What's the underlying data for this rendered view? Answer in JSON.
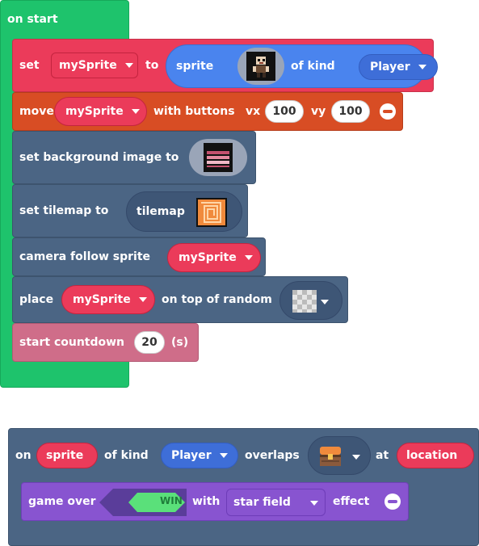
{
  "on_start": {
    "header": "on start",
    "set_sprite": {
      "set": "set",
      "variable": "mySprite",
      "to": "to",
      "sprite": "sprite",
      "of_kind": "of kind",
      "kind": "Player"
    },
    "move": {
      "label": "move",
      "variable": "mySprite",
      "with_buttons": "with buttons",
      "vx_label": "vx",
      "vx": "100",
      "vy_label": "vy",
      "vy": "100"
    },
    "background": {
      "label": "set background image to"
    },
    "tilemap": {
      "label": "set tilemap to",
      "value": "tilemap"
    },
    "camera": {
      "label": "camera follow sprite",
      "variable": "mySprite"
    },
    "place": {
      "label": "place",
      "variable": "mySprite",
      "suffix": "on top of random"
    },
    "countdown": {
      "label": "start countdown",
      "value": "20",
      "unit": "(s)"
    }
  },
  "overlap": {
    "on": "on",
    "sprite": "sprite",
    "of_kind": "of kind",
    "kind": "Player",
    "overlaps": "overlaps",
    "at": "at",
    "location": "location",
    "game_over": {
      "label": "game over",
      "result": "WIN",
      "with": "with",
      "effect_value": "star field",
      "effect": "effect"
    }
  },
  "colors": {
    "events": "#1ec36c",
    "sprites": "#eb3b5a",
    "controller": "#d84d24",
    "scene": "#4b6584",
    "info": "#cf6d89",
    "game": "#8854d0",
    "kind": "#3e6ed8",
    "sprite_reporter": "#4a84ee"
  },
  "icons": {
    "sprite_image": "pixel-character-icon",
    "background_image": "pink-brick-image-icon",
    "tilemap_image": "orange-maze-icon",
    "tile_image": "transparent-checker-icon",
    "overlap_image": "treasure-chest-icon",
    "remove": "minus-circle-icon",
    "dropdown": "caret-down-icon"
  }
}
